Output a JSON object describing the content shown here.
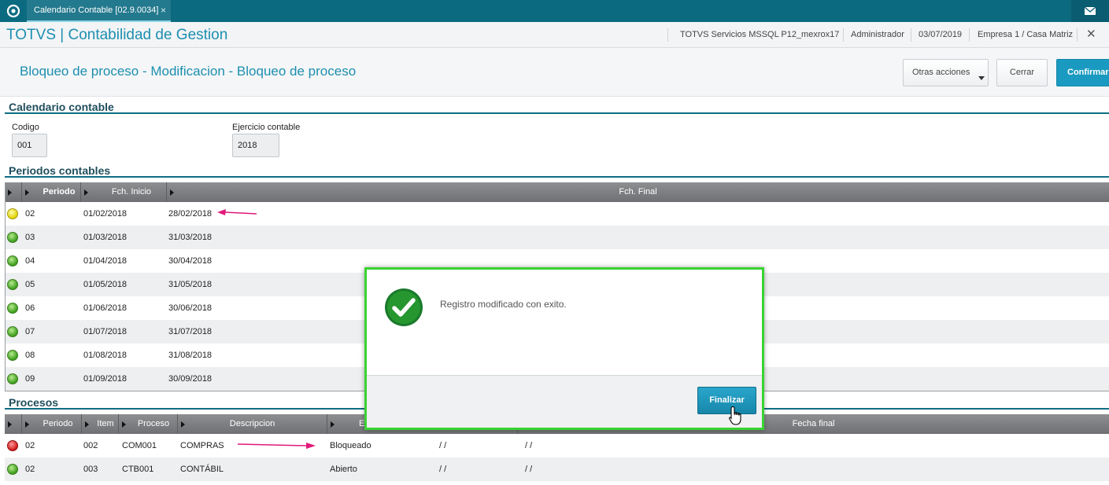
{
  "tabbar": {
    "tab_label": "Calendario Contable [02.9.0034]",
    "tab_close": "×"
  },
  "header": {
    "app_title": "TOTVS | Contabilidad de Gestion",
    "environment": "TOTVS Servicios MSSQL P12_mexrox17",
    "user": "Administrador",
    "date": "03/07/2019",
    "company": "Empresa 1 / Casa Matriz",
    "close": "✕"
  },
  "toolbar": {
    "page_title": "Bloqueo de proceso - Modificacion - Bloqueo de proceso",
    "otras_label": "Otras acciones",
    "cerrar_label": "Cerrar",
    "confirmar_label": "Confirmar"
  },
  "calendario": {
    "section_title": "Calendario contable",
    "codigo_label": "Codigo",
    "codigo_value": "001",
    "ejercicio_label": "Ejercicio contable",
    "ejercicio_value": "2018"
  },
  "periodos": {
    "section_title": "Periodos contables",
    "columns": [
      "Periodo",
      "Fch. Inicio",
      "Fch. Final"
    ],
    "rows": [
      {
        "status": "yellow",
        "periodo": "02",
        "inicio": "01/02/2018",
        "final": "28/02/2018"
      },
      {
        "status": "green",
        "periodo": "03",
        "inicio": "01/03/2018",
        "final": "31/03/2018"
      },
      {
        "status": "green",
        "periodo": "04",
        "inicio": "01/04/2018",
        "final": "30/04/2018"
      },
      {
        "status": "green",
        "periodo": "05",
        "inicio": "01/05/2018",
        "final": "31/05/2018"
      },
      {
        "status": "green",
        "periodo": "06",
        "inicio": "01/06/2018",
        "final": "30/06/2018"
      },
      {
        "status": "green",
        "periodo": "07",
        "inicio": "01/07/2018",
        "final": "31/07/2018"
      },
      {
        "status": "green",
        "periodo": "08",
        "inicio": "01/08/2018",
        "final": "31/08/2018"
      },
      {
        "status": "green",
        "periodo": "09",
        "inicio": "01/09/2018",
        "final": "30/09/2018"
      }
    ]
  },
  "procesos": {
    "section_title": "Procesos",
    "columns": [
      "Periodo",
      "Item",
      "Proceso",
      "Descripcion",
      "E",
      "Fecha final"
    ],
    "rows": [
      {
        "status": "red",
        "periodo": "02",
        "item": "002",
        "proceso": "COM001",
        "descripcion": "COMPRAS",
        "estado": "Bloqueado",
        "fecha_inicio": "/ /",
        "fecha_final": "/ /"
      },
      {
        "status": "green",
        "periodo": "02",
        "item": "003",
        "proceso": "CTB001",
        "descripcion": "CONTÁBIL",
        "estado": "Abierto",
        "fecha_inicio": "/ /",
        "fecha_final": "/ /"
      }
    ]
  },
  "dialog": {
    "message": "Registro modificado con exito.",
    "button_label": "Finalizar"
  },
  "colors": {
    "accent": "#1d8fb0",
    "tabbar": "#0b6a80",
    "dialog_border": "#39d332",
    "annotation_arrow": "#e0197a"
  }
}
